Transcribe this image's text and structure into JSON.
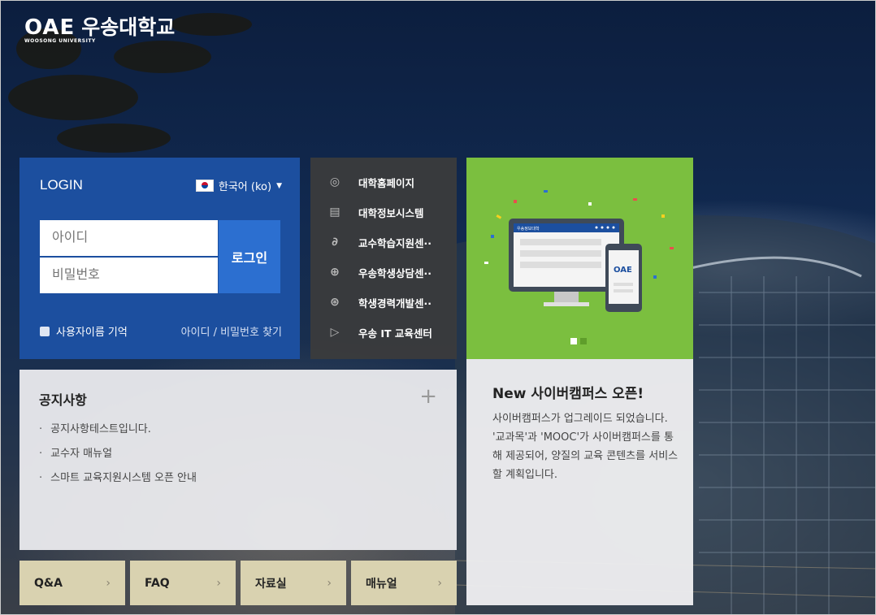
{
  "brand": {
    "mark": "OAE",
    "name": "우송대학교",
    "sub": "WOOSONG UNIVERSITY"
  },
  "login": {
    "title": "LOGIN",
    "language": "한국어 (ko)",
    "id_placeholder": "아이디",
    "pw_placeholder": "비밀번호",
    "login_button": "로그인",
    "remember_label": "사용자이름 기억",
    "find_link": "아이디 / 비밀번호 찾기"
  },
  "menu": {
    "items": [
      {
        "label": "대학홈페이지",
        "icon": "layers-icon"
      },
      {
        "label": "대학정보시스템",
        "icon": "film-icon"
      },
      {
        "label": "교수학습지원센··",
        "icon": "link-icon"
      },
      {
        "label": "우송학생상담센··",
        "icon": "compass-icon"
      },
      {
        "label": "학생경력개발센··",
        "icon": "globe-icon"
      },
      {
        "label": "우송 IT 교육센터",
        "icon": "play-icon"
      }
    ]
  },
  "banner": {
    "bar_title": "우송정보대학",
    "screen_mark": "OAE"
  },
  "notice": {
    "title": "공지사항",
    "items": [
      "공지사항테스트입니다.",
      "교수자 매뉴얼",
      "스마트 교육지원시스템 오픈 안내"
    ]
  },
  "tabs": [
    {
      "label": "Q&A"
    },
    {
      "label": "FAQ"
    },
    {
      "label": "자료실"
    },
    {
      "label": "매뉴얼"
    }
  ],
  "news": {
    "title": "New 사이버캠퍼스 오픈!",
    "body": "사이버캠퍼스가 업그레이드 되었습니다. '교과목'과 'MOOC'가 사이버캠퍼스를 통해 제공되어, 양질의 교육 콘텐츠를 서비스 할 계획입니다."
  },
  "colors": {
    "login_bg": "#1c4f9f",
    "login_btn": "#2c6fd0",
    "banner_green": "#7bbf3f",
    "tab_bg": "#d9d2b0"
  }
}
